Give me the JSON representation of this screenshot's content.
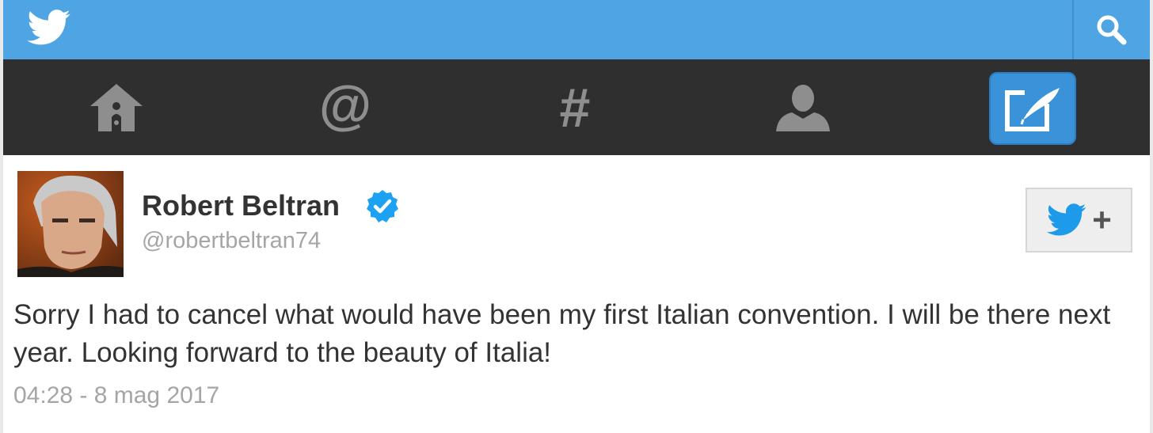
{
  "colors": {
    "topbar": "#4fa5e3",
    "navbar": "#2f2f2f",
    "compose_active": "#3a93d9",
    "nav_icon": "#8e8e8e",
    "verified": "#1da1f2",
    "text": "#333333",
    "muted": "#a5a5a5"
  },
  "header": {
    "brand_icon": "twitter-bird-icon",
    "search_icon": "search-icon"
  },
  "nav": {
    "items": [
      {
        "icon": "home-icon"
      },
      {
        "icon": "at-mentions-icon"
      },
      {
        "icon": "hashtag-icon"
      },
      {
        "icon": "profile-icon"
      },
      {
        "icon": "compose-icon",
        "active": true
      }
    ]
  },
  "tweet": {
    "author_name": "Robert Beltran",
    "handle": "@robertbeltran74",
    "verified": true,
    "text": "Sorry I had to cancel what would have been my first Italian convention. I will be there next year. Looking forward to the beauty of Italia!",
    "timestamp": "04:28 - 8 mag 2017",
    "follow_label": "+"
  }
}
